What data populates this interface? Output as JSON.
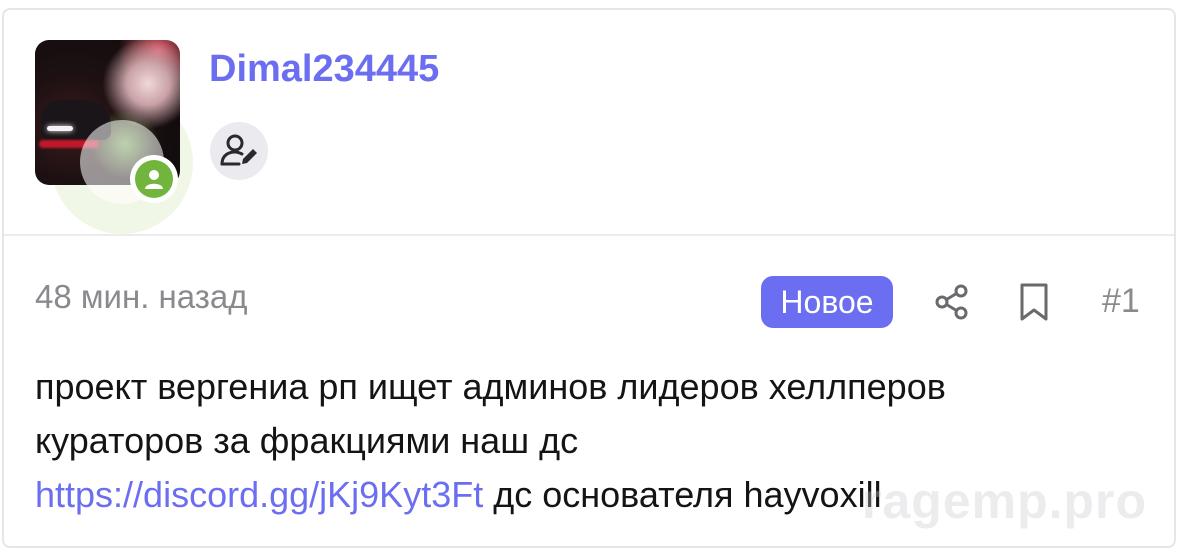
{
  "post": {
    "author": {
      "username": "Dimal234445",
      "avatar_icon": "user-avatar-photo",
      "status_icon": "online-user-icon",
      "role_icon": "user-edit-icon"
    },
    "time": "48 мин. назад",
    "badge": "Новое",
    "share_icon": "share-icon",
    "bookmark_icon": "bookmark-icon",
    "number": "#1",
    "text_line1": "проект вергениа рп ищет админов лидеров хеллперов",
    "text_line2": "кураторов за фракциями наш дс",
    "link": "https://discord.gg/jKj9Kyt3Ft",
    "text_after_link": " дс основателя hayvoxill"
  },
  "watermark": "ragemp.pro",
  "colors": {
    "accent": "#6b6ef0",
    "online": "#72b53e",
    "muted": "#8a8a8e",
    "text": "#141414"
  }
}
